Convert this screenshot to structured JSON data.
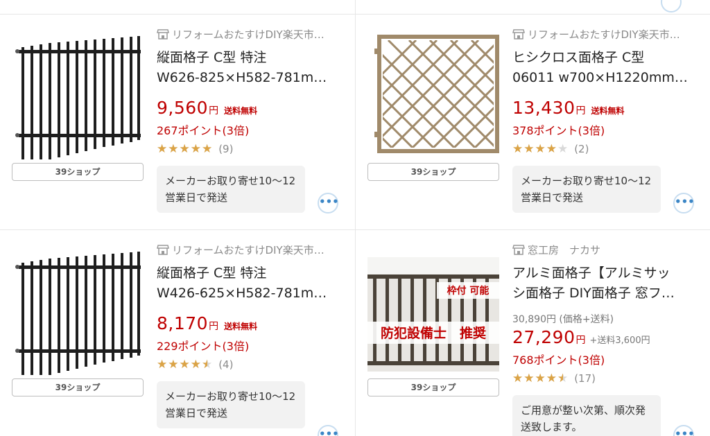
{
  "products": [
    {
      "shop_name": "リフォームおたすけDIY楽天市…",
      "shop_icon": "store-icon",
      "title_lines": [
        "縦面格子 C型 特注",
        "W626-825×H582-781m…"
      ],
      "price": "9,560",
      "yen": "円",
      "shipping": "送料無料",
      "points": "267ポイント(3倍)",
      "rating": 5.0,
      "stars": "★★★★★",
      "review_count": "(9)",
      "shop_tag": "39ショップ",
      "delivery": "メーカーお取り寄せ10〜12営業日で発送",
      "image": "vertical-lattice-black"
    },
    {
      "shop_name": "リフォームおたすけDIY楽天市…",
      "shop_icon": "store-icon",
      "title_lines": [
        "ヒシクロス面格子 C型",
        "06011 w700×H1220mm…"
      ],
      "price": "13,430",
      "yen": "円",
      "shipping": "送料無料",
      "points": "378ポイント(3倍)",
      "rating": 4.0,
      "stars": "★★★★★",
      "review_count": "(2)",
      "shop_tag": "39ショップ",
      "delivery": "メーカーお取り寄せ10〜12営業日で発送",
      "image": "diamond-lattice-bronze"
    },
    {
      "shop_name": "リフォームおたすけDIY楽天市…",
      "shop_icon": "store-icon",
      "title_lines": [
        "縦面格子 C型 特注",
        "W426-625×H582-781m…"
      ],
      "price": "8,170",
      "yen": "円",
      "shipping": "送料無料",
      "points": "229ポイント(3倍)",
      "rating": 4.5,
      "stars": "★★★★★",
      "review_count": "(4)",
      "shop_tag": "39ショップ",
      "delivery": "メーカーお取り寄せ10〜12営業日で発送",
      "image": "vertical-lattice-black"
    },
    {
      "shop_name": "窓工房　ナカサ",
      "shop_icon": "store-icon",
      "title_lines": [
        "アルミ面格子【アルミサッ",
        "シ面格子 DIY面格子 窓フ…"
      ],
      "original_price": "30,890円 (価格+送料)",
      "price": "27,290",
      "yen": "円",
      "shipping_extra": "+送料3,600円",
      "points": "768ポイント(3倍)",
      "rating": 4.5,
      "stars": "★★★★★",
      "review_count": "(17)",
      "shop_tag": "39ショップ",
      "delivery": "ご用意が整い次第、順次発送致します。",
      "image_labels": {
        "badge": "枠付 可能",
        "banner": "防犯設備士　推奨"
      },
      "image": "aluminum-lattice-photo"
    }
  ],
  "more_button_label": "•••",
  "colors": {
    "price_red": "#bf0000",
    "star_gold": "#dba345",
    "link_blue": "#3b86c6"
  }
}
